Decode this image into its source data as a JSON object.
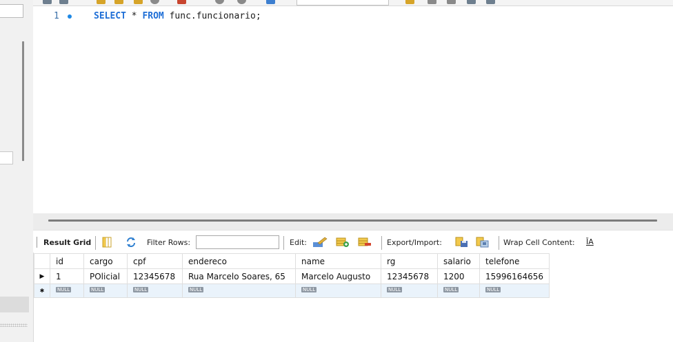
{
  "editor": {
    "line_number": "1",
    "code": {
      "kw_select": "SELECT",
      "star": " * ",
      "kw_from": "FROM",
      "rest": " func.funcionario;"
    }
  },
  "result_toolbar": {
    "result_grid_label": "Result Grid",
    "filter_rows_label": "Filter Rows:",
    "filter_rows_value": "",
    "edit_label": "Edit:",
    "export_import_label": "Export/Import:",
    "wrap_cell_label": "Wrap Cell Content:",
    "wrap_icon_glyph": "ĪA"
  },
  "grid": {
    "columns": [
      "id",
      "cargo",
      "cpf",
      "endereco",
      "name",
      "rg",
      "salario",
      "telefone"
    ],
    "rows": [
      [
        "1",
        "POlicial",
        "12345678",
        "Rua Marcelo Soares, 65",
        "Marcelo Augusto",
        "12345678",
        "1200",
        "15996164656"
      ]
    ],
    "new_row_value": "NULL",
    "current_row_marker": "▶",
    "new_row_marker": "✱"
  },
  "colors": {
    "keyword": "#1e6ed6",
    "line_marker": "#1e88e5",
    "null_badge": "#8e98a3",
    "new_row_bg": "#eaf3fb"
  }
}
